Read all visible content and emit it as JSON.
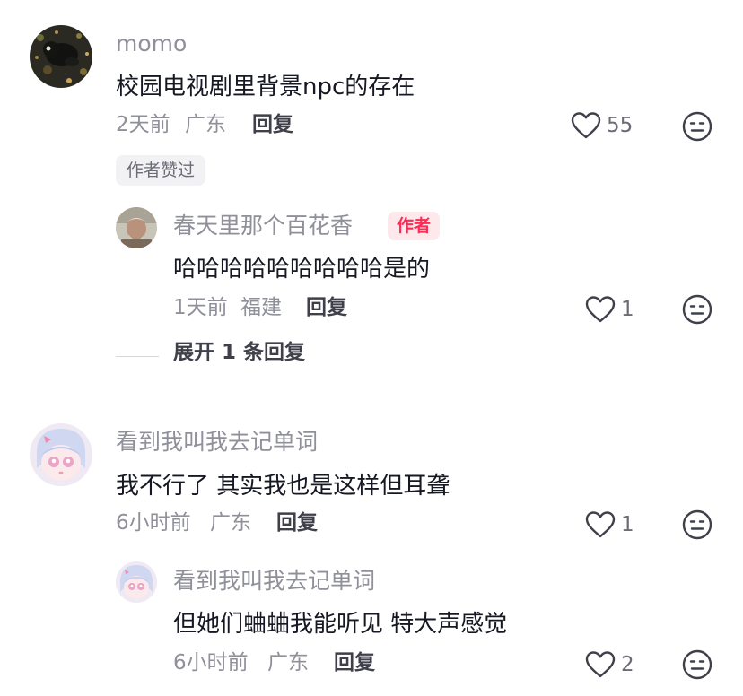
{
  "comments": [
    {
      "username": "momo",
      "content": "校园电视剧里背景npc的存在",
      "time": "2天前",
      "location": "广东",
      "reply_label": "回复",
      "likes": "55",
      "author_liked_label": "作者赞过",
      "replies": [
        {
          "username": "春天里那个百花香",
          "author_badge": "作者",
          "content": "哈哈哈哈哈哈哈哈哈是的",
          "time": "1天前",
          "location": "福建",
          "reply_label": "回复",
          "likes": "1"
        }
      ],
      "expand_label": "展开 1 条回复"
    },
    {
      "username": "看到我叫我去记单词",
      "content": "我不行了 其实我也是这样但耳聋",
      "time": "6小时前",
      "location": "广东",
      "reply_label": "回复",
      "likes": "1",
      "replies": [
        {
          "username": "看到我叫我去记单词",
          "content": "但她们蛐蛐我能听见 特大声感觉",
          "time": "6小时前",
          "location": "广东",
          "reply_label": "回复",
          "likes": "2"
        }
      ]
    }
  ],
  "colors": {
    "primary_text": "#161823",
    "secondary_text": "#8f9099",
    "author_red": "#fe2c55",
    "tag_bg": "#f2f2f4"
  },
  "icons": {
    "like": "heart-outline-icon",
    "dislike": "neutral-face-icon"
  }
}
